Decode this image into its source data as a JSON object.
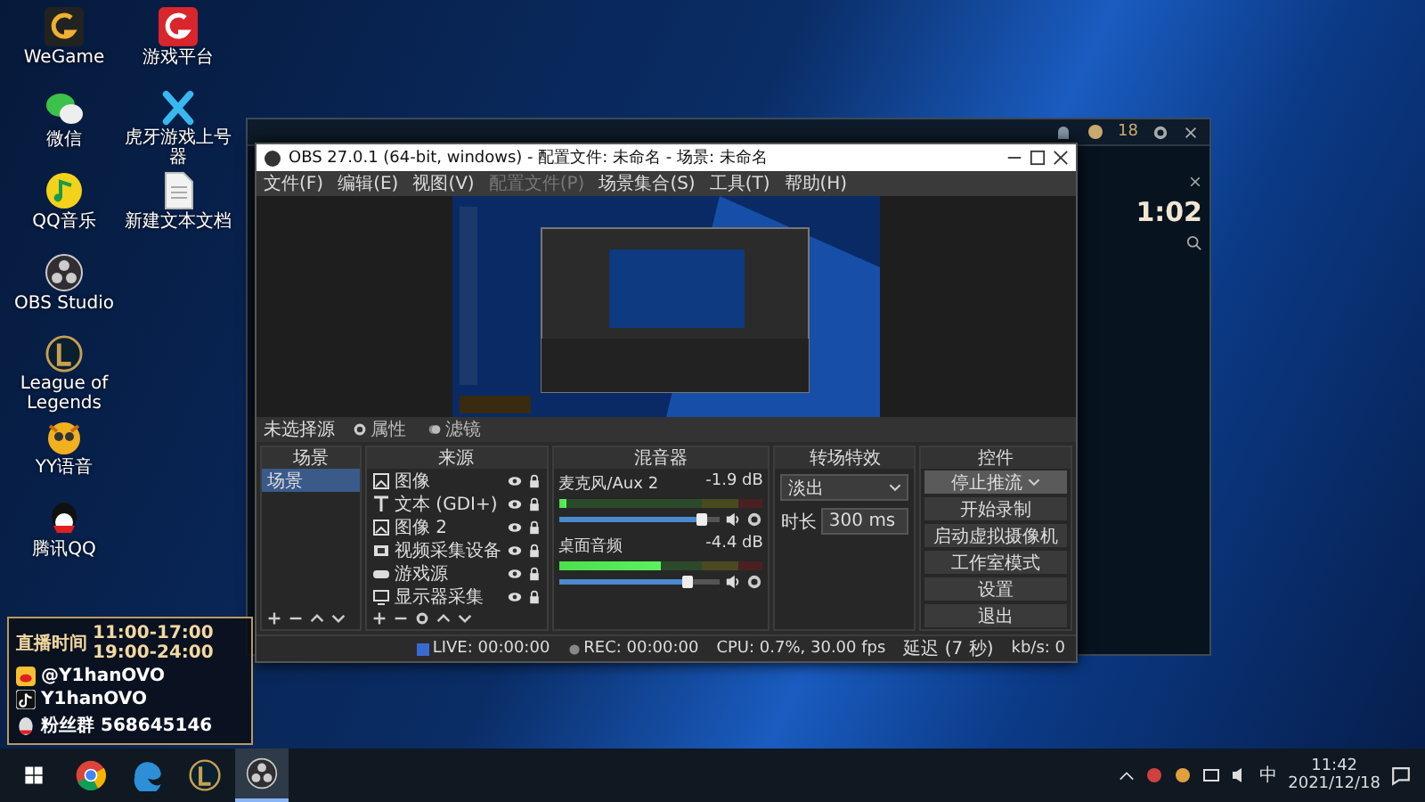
{
  "desktop": {
    "icons": [
      {
        "kind": "wegame",
        "label": "WeGame"
      },
      {
        "kind": "wechat",
        "label": "微信"
      },
      {
        "kind": "music",
        "label": "QQ音乐"
      },
      {
        "kind": "obs",
        "label": "OBS Studio"
      },
      {
        "kind": "lol",
        "label": "League of Legends"
      },
      {
        "kind": "yy",
        "label": "YY语音"
      },
      {
        "kind": "qq",
        "label": "腾讯QQ"
      },
      {
        "kind": "platform",
        "label": "游戏平台"
      },
      {
        "kind": "accelerator",
        "label": "虎牙游戏上号器"
      },
      {
        "kind": "textfile",
        "label": "新建文本文档"
      }
    ]
  },
  "game_client": {
    "badge_count": "18",
    "timer": "1:02"
  },
  "obs": {
    "title": "OBS 27.0.1 (64-bit, windows) - 配置文件: 未命名 - 场景: 未命名",
    "menu": [
      {
        "label": "文件(F)",
        "disabled": false
      },
      {
        "label": "编辑(E)",
        "disabled": false
      },
      {
        "label": "视图(V)",
        "disabled": false
      },
      {
        "label": "配置文件(P)",
        "disabled": true
      },
      {
        "label": "场景集合(S)",
        "disabled": false
      },
      {
        "label": "工具(T)",
        "disabled": false
      },
      {
        "label": "帮助(H)",
        "disabled": false
      }
    ],
    "source_bar": {
      "label": "未选择源",
      "properties": "属性",
      "filters": "滤镜"
    },
    "scenes": {
      "title": "场景",
      "items": [
        {
          "label": "场景",
          "selected": true
        }
      ]
    },
    "sources": {
      "title": "来源",
      "items": [
        {
          "kind": "image",
          "label": "图像"
        },
        {
          "kind": "text",
          "label": "文本 (GDI+)"
        },
        {
          "kind": "image",
          "label": "图像 2"
        },
        {
          "kind": "video",
          "label": "视频采集设备"
        },
        {
          "kind": "game",
          "label": "游戏源"
        },
        {
          "kind": "display",
          "label": "显示器采集"
        }
      ]
    },
    "mixer": {
      "title": "混音器",
      "channels": [
        {
          "name": "麦克风/Aux 2",
          "reading": "-1.9 dB",
          "meter": {
            "level": 0.04
          },
          "volume": {
            "level": 0.88
          }
        },
        {
          "name": "桌面音频",
          "reading": "-4.4 dB",
          "meter": {
            "level": 0.5
          },
          "volume": {
            "level": 0.8
          }
        }
      ]
    },
    "transitions": {
      "title": "转场特效",
      "type": "淡出",
      "duration_label": "时长",
      "duration": "300 ms"
    },
    "controls": {
      "title": "控件",
      "buttons": [
        {
          "label": "停止推流",
          "active": true
        },
        {
          "label": "开始录制",
          "active": false
        },
        {
          "label": "启动虚拟摄像机",
          "active": false
        },
        {
          "label": "工作室模式",
          "active": false
        },
        {
          "label": "设置",
          "active": false
        },
        {
          "label": "退出",
          "active": false
        }
      ]
    },
    "status": {
      "live": "LIVE: 00:00:00",
      "rec": "REC: 00:00:00",
      "cpu": "CPU: 0.7%, 30.00 fps",
      "delay": "延迟 (7 秒)",
      "bitrate": "kb/s: 0"
    }
  },
  "overlay": {
    "schedule_label": "直播时间",
    "times": [
      "11:00-17:00",
      "19:00-24:00"
    ],
    "contacts": [
      {
        "kind": "weibo",
        "text": "@Y1hanOVO"
      },
      {
        "kind": "tiktok",
        "text": "Y1hanOVO"
      },
      {
        "kind": "qq",
        "text": "粉丝群 568645146"
      }
    ]
  },
  "taskbar": {
    "apps": [
      {
        "kind": "chrome",
        "active": false
      },
      {
        "kind": "edge",
        "active": false
      },
      {
        "kind": "lol",
        "active": false
      },
      {
        "kind": "obs",
        "active": true
      }
    ],
    "ime": "中",
    "time": "11:42",
    "date": "2021/12/18"
  }
}
